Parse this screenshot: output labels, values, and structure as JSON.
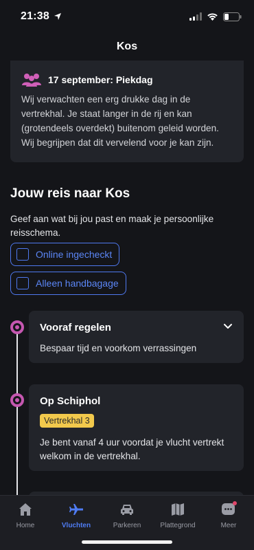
{
  "status_bar": {
    "time": "21:38"
  },
  "nav": {
    "title": "Kos"
  },
  "alert": {
    "title": "17 september: Piekdag",
    "body": "Wij verwachten een erg drukke dag in de vertrekhal. Je staat langer in de rij en kan (grotendeels overdekt) buitenom geleid worden. Wij begrijpen dat dit vervelend voor je kan zijn."
  },
  "journey": {
    "title": "Jouw reis naar Kos",
    "description": "Geef aan wat bij jou past en maak je persoonlijke reisschema.",
    "options": [
      {
        "label": "Online ingecheckt"
      },
      {
        "label": "Alleen handbagage"
      }
    ]
  },
  "timeline": {
    "steps": [
      {
        "title": "Vooraf regelen",
        "subtitle": "Bespaar tijd en voorkom verrassingen"
      },
      {
        "title": "Op Schiphol",
        "badge": "Vertrekhal 3",
        "subtitle": "Je bent vanaf 4 uur voordat je vlucht vertrekt welkom in de vertrekhal."
      }
    ]
  },
  "tabs": [
    {
      "label": "Home",
      "icon": "home-icon"
    },
    {
      "label": "Vluchten",
      "icon": "airplane-icon",
      "active": true
    },
    {
      "label": "Parkeren",
      "icon": "car-icon"
    },
    {
      "label": "Plattegrond",
      "icon": "map-icon"
    },
    {
      "label": "Meer",
      "icon": "chat-icon"
    }
  ],
  "colors": {
    "accent": "#4f79f0",
    "timeline_dot": "#c557b0",
    "badge": "#f2c94c"
  }
}
